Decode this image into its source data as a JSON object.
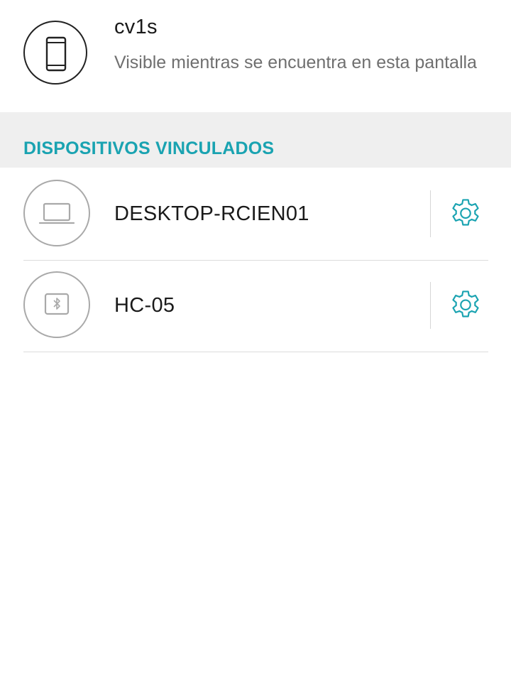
{
  "own_device": {
    "icon": "phone-icon",
    "name": "cv1s",
    "status": "Visible mientras se encuentra en esta pantalla"
  },
  "paired_section": {
    "title": "DISPOSITIVOS VINCULADOS"
  },
  "paired_devices": [
    {
      "name": "DESKTOP-RCIEN01",
      "icon": "laptop-icon",
      "action_icon": "gear-icon"
    },
    {
      "name": "HC-05",
      "icon": "bluetooth-icon",
      "action_icon": "gear-icon"
    }
  ],
  "colors": {
    "accent": "#1aa3b1",
    "section_background": "#efefef",
    "primary_text": "#1a1a1a",
    "secondary_text": "#6f6f6f",
    "icon_outline": "#a9a9a9"
  }
}
